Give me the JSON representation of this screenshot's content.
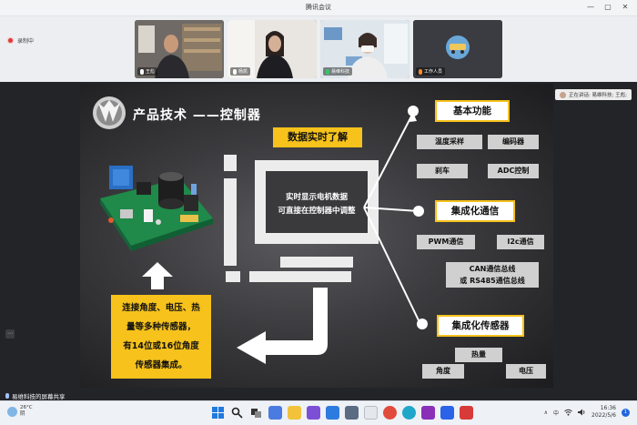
{
  "window": {
    "title": "腾讯会议",
    "controls": [
      "—",
      "▢",
      "✕"
    ]
  },
  "recording": {
    "label": "录制中"
  },
  "participants": [
    {
      "name": "王彪",
      "mic_active": false
    },
    {
      "name": "杨凯",
      "mic_active": false
    },
    {
      "name": "易维科技",
      "mic_active": true
    },
    {
      "name": "工作人员",
      "mic_active": false
    }
  ],
  "speaking": {
    "label": "正在讲话: 易维科技; 王彪;"
  },
  "slide": {
    "title": "产品技术 ——控制器",
    "realtime_banner": "数据实时了解",
    "monitor_text": [
      "实时显示电机数据",
      "可直接在控制器中调整"
    ],
    "sensor_desc": [
      "连接角度、电压、热",
      "量等多种传感器，",
      "有14位或16位角度",
      "传感器集成。"
    ],
    "sections": [
      {
        "heading": "基本功能",
        "items": [
          "温度采样",
          "编码器",
          "刹车",
          "ADC控制"
        ]
      },
      {
        "heading": "集成化通信",
        "items": [
          "PWM通信",
          "I2c通信",
          "CAN通信总线",
          "或   RS485通信总线"
        ]
      },
      {
        "heading": "集成化传感器",
        "items": [
          "热量",
          "角度",
          "电压"
        ]
      }
    ],
    "colors": {
      "accent": "#f6c21b",
      "item_bg": "#d0d0d0"
    }
  },
  "screen_share": {
    "label": "易维科技的屏幕共享"
  },
  "taskbar": {
    "weather": {
      "temp": "26°C",
      "condition": "阴"
    },
    "tray": {
      "ime": "中",
      "time": "16:36",
      "date": "2022/5/6",
      "notifications": "1"
    },
    "tray_icon_names": [
      "chevron-up-icon",
      "wifi-icon",
      "volume-icon"
    ],
    "app_icon_names": [
      "start-icon",
      "search-icon",
      "task-view-icon",
      "widgets-icon",
      "file-explorer-icon",
      "visual-studio-icon",
      "mail-icon",
      "store-icon",
      "photos-icon",
      "chrome-icon",
      "edge-icon",
      "onenote-icon",
      "tencent-meeting-icon",
      "wps-icon"
    ]
  }
}
